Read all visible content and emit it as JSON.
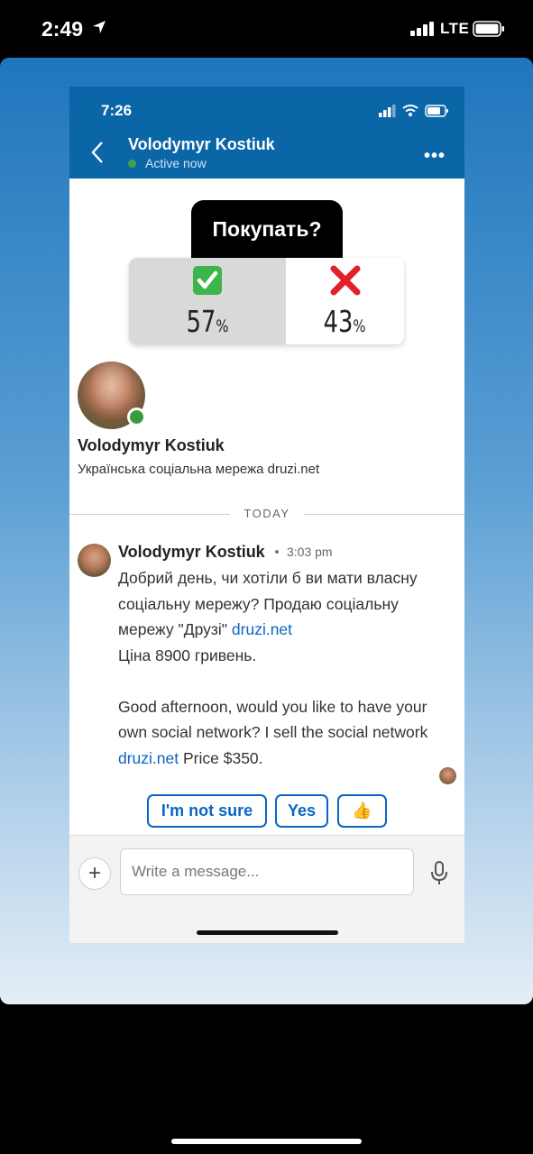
{
  "outer_status": {
    "time": "2:49",
    "network": "LTE"
  },
  "inner_status": {
    "time": "7:26"
  },
  "header": {
    "name": "Volodymyr Kostiuk",
    "status": "Active now"
  },
  "poll": {
    "question": "Покупать?",
    "options": [
      {
        "icon": "check-mark-icon",
        "value": "57",
        "unit": "%"
      },
      {
        "icon": "cross-mark-icon",
        "value": "43",
        "unit": "%"
      }
    ]
  },
  "profile": {
    "name": "Volodymyr Kostiuk",
    "headline": "Українська соціальна мережа druzi.net"
  },
  "divider": {
    "label": "TODAY"
  },
  "message": {
    "sender": "Volodymyr Kostiuk",
    "time": "3:03 pm",
    "uk_text_1": "Добрий день, чи хотіли б ви мати власну соціальну мережу? Продаю соціальну мережу \"Друзі\"",
    "uk_link": "druzi.net",
    "uk_price": "Ціна 8900 гривень.",
    "en_text_1": "Good afternoon, would you like to have your own social network? I sell the social network",
    "en_link": "druzi.net",
    "en_price": "Price $350."
  },
  "quick_replies": [
    "I'm not sure",
    "Yes",
    "👍"
  ],
  "composer": {
    "placeholder": "Write a message..."
  },
  "colors": {
    "linkedin_blue": "#0a66c2",
    "header_bg": "#0b66a8",
    "online_green": "#3b9a3b"
  }
}
